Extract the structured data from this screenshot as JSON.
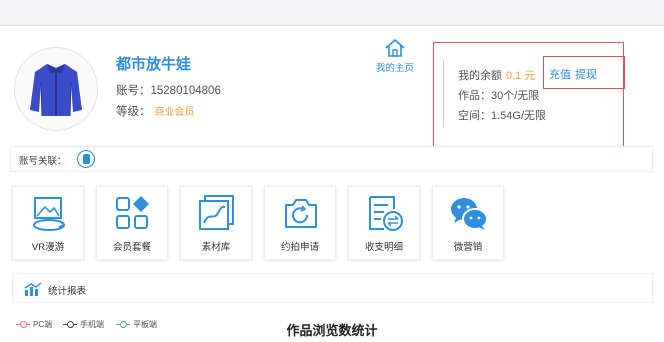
{
  "profile": {
    "username": "都市放牛娃",
    "account_label": "账号：",
    "account_number": "15280104806",
    "level_label": "等级：",
    "level_value": "商业会员",
    "home_link": "我的主页"
  },
  "account_box": {
    "balance_label": "我的余额",
    "balance_amount": "0.1",
    "balance_unit": "元",
    "works": "作品：30个/无限",
    "space": "空间：1.54G/无限",
    "recharge": "充值",
    "withdraw": "提现"
  },
  "link_bar": {
    "label": "账号关联："
  },
  "tiles": [
    {
      "label": "VR漫游",
      "icon": "vr-tour-icon"
    },
    {
      "label": "会员套餐",
      "icon": "membership-package-icon"
    },
    {
      "label": "素材库",
      "icon": "material-library-icon"
    },
    {
      "label": "约拍申请",
      "icon": "photoshoot-request-icon"
    },
    {
      "label": "收支明细",
      "icon": "income-expense-icon"
    },
    {
      "label": "微营销",
      "icon": "wechat-marketing-icon"
    }
  ],
  "stats": {
    "label": "统计报表",
    "legend": [
      "PC端",
      "手机端",
      "平板端"
    ],
    "chart_title": "作品浏览数统计"
  },
  "colors": {
    "accent": "#2f8fdc",
    "gold": "#e8a23c",
    "highlight_border": "#d9585a",
    "legend_pc": "#e06e6e",
    "legend_mobile": "#444444",
    "legend_tablet": "#5aa0a8"
  }
}
